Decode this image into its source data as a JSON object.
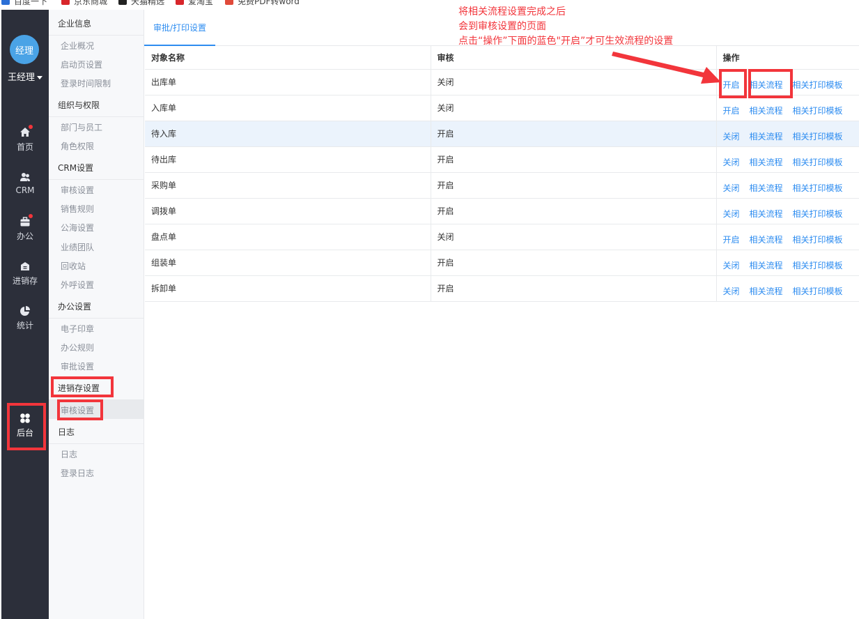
{
  "bookmarks": [
    {
      "label": "百度一下",
      "color": "#2b6fd6"
    },
    {
      "label": "京东商城",
      "color": "#d8262b"
    },
    {
      "label": "天猫精选",
      "color": "#222222"
    },
    {
      "label": "爱淘宝",
      "color": "#d8262b"
    },
    {
      "label": "免费PDF转word",
      "color": "#e04a3a"
    }
  ],
  "user": {
    "avatar_text": "经理",
    "name": "王经理"
  },
  "nav": [
    {
      "label": "首页",
      "icon": "home-icon",
      "badge": true
    },
    {
      "label": "CRM",
      "icon": "users-icon",
      "badge": false
    },
    {
      "label": "办公",
      "icon": "briefcase-icon",
      "badge": true
    },
    {
      "label": "进销存",
      "icon": "warehouse-icon",
      "badge": false
    },
    {
      "label": "统计",
      "icon": "pie-chart-icon",
      "badge": false
    },
    {
      "label": "后台",
      "icon": "grid-icon",
      "badge": false,
      "active": true
    }
  ],
  "subnav": {
    "sections": [
      {
        "title": "企业信息",
        "items": [
          "企业概况",
          "启动页设置",
          "登录时间限制"
        ]
      },
      {
        "title": "组织与权限",
        "items": [
          "部门与员工",
          "角色权限"
        ]
      },
      {
        "title": "CRM设置",
        "items": [
          "审核设置",
          "销售规则",
          "公海设置",
          "业绩团队",
          "回收站",
          "外呼设置"
        ]
      },
      {
        "title": "办公设置",
        "items": [
          "电子印章",
          "办公规则",
          "审批设置"
        ]
      },
      {
        "title": "进销存设置",
        "items": [
          "审核设置"
        ]
      },
      {
        "title": "日志",
        "items": [
          "日志",
          "登录日志"
        ]
      }
    ]
  },
  "tab_label": "审批/打印设置",
  "table": {
    "headers": [
      "对象名称",
      "审核",
      "操作"
    ],
    "actions": [
      "相关流程",
      "相关打印模板"
    ],
    "rows": [
      {
        "name": "出库单",
        "status": "关闭",
        "toggle": "开启"
      },
      {
        "name": "入库单",
        "status": "关闭",
        "toggle": "开启"
      },
      {
        "name": "待入库",
        "status": "开启",
        "toggle": "关闭"
      },
      {
        "name": "待出库",
        "status": "开启",
        "toggle": "关闭"
      },
      {
        "name": "采购单",
        "status": "开启",
        "toggle": "关闭"
      },
      {
        "name": "调拨单",
        "status": "开启",
        "toggle": "关闭"
      },
      {
        "name": "盘点单",
        "status": "关闭",
        "toggle": "开启"
      },
      {
        "name": "组装单",
        "status": "开启",
        "toggle": "关闭"
      },
      {
        "name": "拆卸单",
        "status": "开启",
        "toggle": "关闭"
      }
    ]
  },
  "annotation": {
    "lines": [
      "将相关流程设置完成之后",
      "会到审核设置的页面",
      "点击“操作”下面的蓝色\"开启”才可生效流程的设置"
    ],
    "color": "#f2353b"
  },
  "colors": {
    "accent": "#2d8cf0",
    "nav_bg": "#2c2f3a",
    "highlight_row": "#ebf3fc"
  }
}
